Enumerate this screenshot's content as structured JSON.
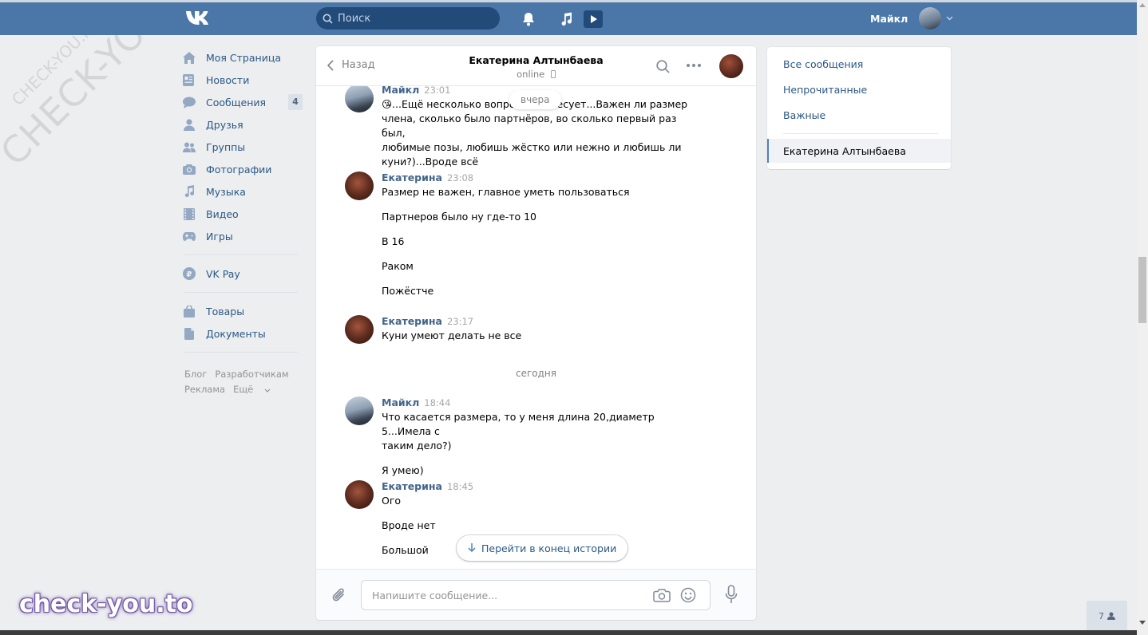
{
  "topbar": {
    "search_placeholder": "Поиск",
    "user_name": "Майкл",
    "color": "#4a76a8"
  },
  "leftnav": {
    "items": [
      {
        "label": "Моя Страница",
        "icon": "home-icon"
      },
      {
        "label": "Новости",
        "icon": "news-icon"
      },
      {
        "label": "Сообщения",
        "icon": "messages-icon",
        "badge": "4"
      },
      {
        "label": "Друзья",
        "icon": "friends-icon"
      },
      {
        "label": "Группы",
        "icon": "groups-icon"
      },
      {
        "label": "Фотографии",
        "icon": "camera-icon"
      },
      {
        "label": "Музыка",
        "icon": "music-note-icon"
      },
      {
        "label": "Видео",
        "icon": "video-icon"
      },
      {
        "label": "Игры",
        "icon": "gamepad-icon"
      }
    ],
    "vkpay": "VK Pay",
    "items2": [
      {
        "label": "Товары",
        "icon": "shopping-bag-icon"
      },
      {
        "label": "Документы",
        "icon": "document-icon"
      }
    ],
    "footer": {
      "blog": "Блог",
      "dev": "Разработчикам",
      "ads": "Реклама",
      "more": "Ещё"
    }
  },
  "chat": {
    "back_label": "Назад",
    "title": "Екатерина Алтынбаева",
    "status": "online",
    "day_pill": "вчера",
    "day_today": "сегодня",
    "goto_end": "Перейти в конец истории",
    "input_placeholder": "Напишите сообщение...",
    "messages": [
      {
        "author": "Майкл",
        "time": "23:01",
        "lines": [
          "😘...Ещё несколько вопро",
          "члена, сколько было партнёров, во сколько первый раз был,",
          "любимые позы, любишь жёстко или нежно и любишь ли",
          "куни?)...Вроде всё"
        ],
        "first_tail": "есует...Важен ли размер"
      },
      {
        "author": "Екатерина",
        "time": "23:08",
        "lines": [
          "Размер не важен, главное уметь пользоваться",
          "Партнеров было ну где-то 10",
          "В 16",
          "Раком",
          "Пожёстче"
        ]
      },
      {
        "author": "Екатерина",
        "time": "23:17",
        "lines": [
          "Куни умеют делать не все"
        ]
      },
      {
        "author": "Майкл",
        "time": "18:44",
        "lines": [
          "Что касается размера, то у меня длина 20,диаметр 5...Имела с",
          "таким дело?)",
          "Я умею)"
        ]
      },
      {
        "author": "Екатерина",
        "time": "18:45",
        "lines": [
          "Ого",
          "Вроде нет",
          "Большой"
        ]
      }
    ]
  },
  "rightpanel": {
    "all": "Все сообщения",
    "unread": "Непрочитанные",
    "important": "Важные",
    "active_chat": "Екатерина Алтынбаева"
  },
  "fab_count": "7",
  "watermarks": {
    "big": "CHECK-YOU.ME",
    "small": "CHECK-YOU.ME",
    "brand": "check-you.to"
  }
}
